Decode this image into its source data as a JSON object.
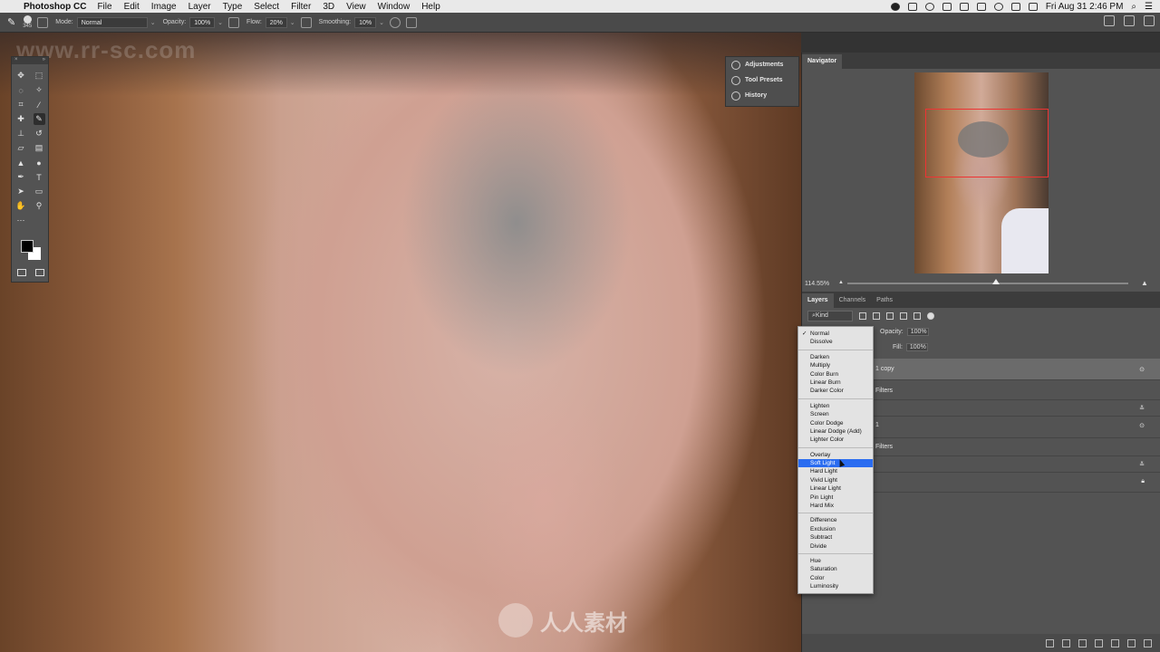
{
  "menubar": {
    "app": "Photoshop CC",
    "items": [
      "File",
      "Edit",
      "Image",
      "Layer",
      "Type",
      "Select",
      "Filter",
      "3D",
      "View",
      "Window",
      "Help"
    ],
    "clock": "Fri Aug 31  2:46 PM"
  },
  "options": {
    "mode_label": "Mode:",
    "mode_value": "Normal",
    "opacity_label": "Opacity:",
    "opacity_value": "100%",
    "flow_label": "Flow:",
    "flow_value": "20%",
    "smoothing_label": "Smoothing:",
    "smoothing_value": "10%",
    "brush_size": "345"
  },
  "canvas": {
    "watermark": "www.rr-sc.com",
    "logo_text": "人人素材"
  },
  "mini_panels": [
    "Adjustments",
    "Tool Presets",
    "History"
  ],
  "navigator": {
    "tab": "Navigator",
    "zoom": "114.55%"
  },
  "layers": {
    "tabs": [
      "Layers",
      "Channels",
      "Paths"
    ],
    "kind": "Kind",
    "opacity_label": "Opacity:",
    "opacity_value": "100%",
    "fill_label": "Fill:",
    "fill_value": "100%",
    "rows": [
      "1 copy",
      "Filters",
      "1",
      "Filters"
    ]
  },
  "blend_menu": {
    "groups": [
      [
        "Normal",
        "Dissolve"
      ],
      [
        "Darken",
        "Multiply",
        "Color Burn",
        "Linear Burn",
        "Darker Color"
      ],
      [
        "Lighten",
        "Screen",
        "Color Dodge",
        "Linear Dodge (Add)",
        "Lighter Color"
      ],
      [
        "Overlay",
        "Soft Light",
        "Hard Light",
        "Vivid Light",
        "Linear Light",
        "Pin Light",
        "Hard Mix"
      ],
      [
        "Difference",
        "Exclusion",
        "Subtract",
        "Divide"
      ],
      [
        "Hue",
        "Saturation",
        "Color",
        "Luminosity"
      ]
    ],
    "checked": "Normal",
    "highlighted": "Soft Light"
  }
}
